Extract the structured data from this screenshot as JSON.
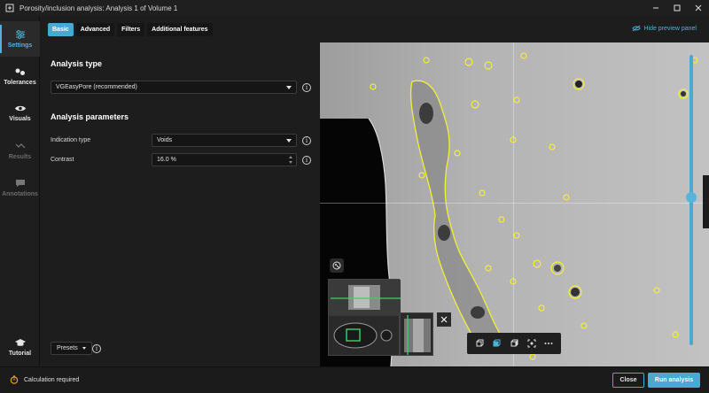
{
  "window": {
    "title": "Porosity/inclusion analysis: Analysis 1 of Volume 1"
  },
  "rail": {
    "items": [
      {
        "label": "Settings",
        "icon": "sliders-icon",
        "state": "active"
      },
      {
        "label": "Tolerances",
        "icon": "tolerances-icon",
        "state": "enabled"
      },
      {
        "label": "Visuals",
        "icon": "eye-icon",
        "state": "enabled"
      },
      {
        "label": "Results",
        "icon": "results-icon",
        "state": "disabled"
      },
      {
        "label": "Annotations",
        "icon": "comment-icon",
        "state": "disabled"
      },
      {
        "label": "Tutorial",
        "icon": "graduation-cap-icon",
        "state": "enabled"
      }
    ]
  },
  "tabs": [
    {
      "label": "Basic",
      "active": true
    },
    {
      "label": "Advanced",
      "active": false
    },
    {
      "label": "Filters",
      "active": false
    },
    {
      "label": "Additional features",
      "active": false
    }
  ],
  "analysis_type": {
    "heading": "Analysis type",
    "selected": "VGEasyPore (recommended)"
  },
  "parameters": {
    "heading": "Analysis parameters",
    "indication_label": "Indication type",
    "indication_value": "Voids",
    "contrast_label": "Contrast",
    "contrast_value": "16.0 %"
  },
  "presets_label": "Presets",
  "preview": {
    "hide_label": "Hide preview panel",
    "slider_level": 0.49
  },
  "footer": {
    "status": "Calculation required",
    "close_label": "Close",
    "run_label": "Run analysis"
  },
  "colors": {
    "accent": "#4aa9cf",
    "highlight": "#f2ef3a",
    "status_warning": "#e3a127"
  }
}
